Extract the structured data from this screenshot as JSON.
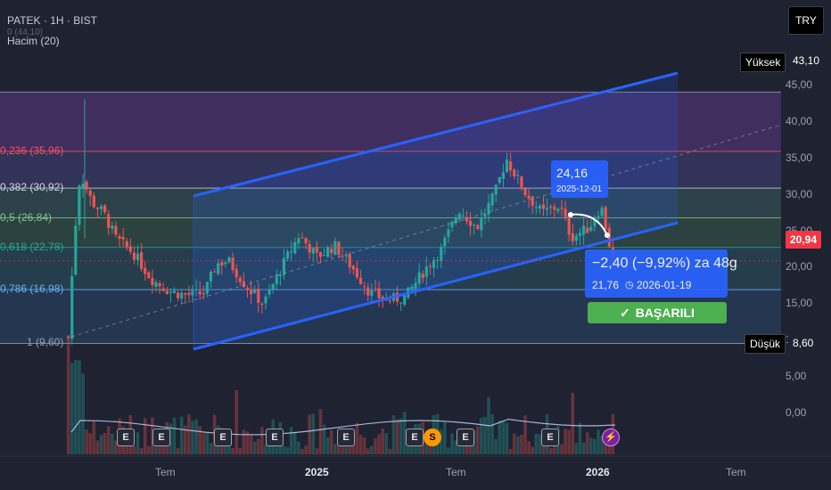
{
  "header": {
    "symbol_line": "PATEK · 1H · BIST",
    "volume_label": "Hacim (20)",
    "cut_label": "0 (44,10)"
  },
  "currency_button": "TRY",
  "y_axis": {
    "ticks": [
      "45,00",
      "40,00",
      "35,00",
      "30,00",
      "25,00",
      "20,00",
      "15,00",
      "10,00",
      "5,00",
      "0,00"
    ],
    "tags": {
      "high_label": "Yüksek",
      "high_value": "43,10",
      "current_value": "20,94",
      "low_label": "Düşük",
      "low_value": "8,60"
    }
  },
  "x_axis": {
    "ticks": [
      {
        "label": "Tem",
        "bold": false
      },
      {
        "label": "2025",
        "bold": true
      },
      {
        "label": "Tem",
        "bold": false
      },
      {
        "label": "2026",
        "bold": true
      },
      {
        "label": "Tem",
        "bold": false
      }
    ]
  },
  "fib_levels": [
    {
      "label": "0,236 (35,96)",
      "color": "#f7525f"
    },
    {
      "label": "0,382 (30,92)",
      "color": "#d1d4dc"
    },
    {
      "label": "0,5 (26,84)",
      "color": "#81c784"
    },
    {
      "label": "0,618 (22,78)",
      "color": "#26a69a"
    },
    {
      "label": "0,786 (16,98)",
      "color": "#64b5f6"
    },
    {
      "label": "1 (9,60)",
      "color": "#9aa0ad"
    }
  ],
  "annotations": {
    "entry_price": "24,16",
    "entry_date": "2025-12-01",
    "move_text": "−2,40 (−9,92%) za 48g",
    "target_price": "21,76",
    "target_date": "2026-01-19",
    "status": "BAŞARILI"
  },
  "events": [
    "E",
    "E",
    "E",
    "E",
    "E",
    "E",
    "S",
    "E",
    "E",
    "⚡"
  ],
  "colors": {
    "up": "#26a69a",
    "down": "#ef5350",
    "channel": "#2962ff",
    "success": "#4caf50"
  },
  "chart_data": {
    "type": "candlestick",
    "title": "PATEK · 1H · BIST",
    "y_range": [
      -4,
      48
    ],
    "fibonacci": [
      {
        "ratio": 0,
        "price": 44.1
      },
      {
        "ratio": 0.236,
        "price": 35.96
      },
      {
        "ratio": 0.382,
        "price": 30.92
      },
      {
        "ratio": 0.5,
        "price": 26.84
      },
      {
        "ratio": 0.618,
        "price": 22.78
      },
      {
        "ratio": 0.786,
        "price": 16.98
      },
      {
        "ratio": 1,
        "price": 9.6
      }
    ],
    "close_series": [
      {
        "date": "2024-04-15",
        "close": 10.5
      },
      {
        "date": "2024-04-22",
        "close": 24.0
      },
      {
        "date": "2024-04-29",
        "close": 33.0
      },
      {
        "date": "2024-05-13",
        "close": 29.0
      },
      {
        "date": "2024-05-27",
        "close": 27.5
      },
      {
        "date": "2024-06-10",
        "close": 24.0
      },
      {
        "date": "2024-07-01",
        "close": 22.0
      },
      {
        "date": "2024-07-22",
        "close": 18.5
      },
      {
        "date": "2024-08-12",
        "close": 16.8
      },
      {
        "date": "2024-09-02",
        "close": 16.2
      },
      {
        "date": "2024-09-23",
        "close": 16.5
      },
      {
        "date": "2024-10-07",
        "close": 20.5
      },
      {
        "date": "2024-10-21",
        "close": 21.0
      },
      {
        "date": "2024-11-11",
        "close": 17.5
      },
      {
        "date": "2024-12-02",
        "close": 15.0
      },
      {
        "date": "2024-12-23",
        "close": 20.0
      },
      {
        "date": "2025-01-13",
        "close": 24.5
      },
      {
        "date": "2025-02-03",
        "close": 21.5
      },
      {
        "date": "2025-02-24",
        "close": 23.0
      },
      {
        "date": "2025-03-17",
        "close": 20.0
      },
      {
        "date": "2025-04-07",
        "close": 16.5
      },
      {
        "date": "2025-04-28",
        "close": 15.5
      },
      {
        "date": "2025-05-19",
        "close": 16.0
      },
      {
        "date": "2025-06-09",
        "close": 19.5
      },
      {
        "date": "2025-06-30",
        "close": 22.5
      },
      {
        "date": "2025-07-21",
        "close": 28.0
      },
      {
        "date": "2025-08-11",
        "close": 25.5
      },
      {
        "date": "2025-09-01",
        "close": 30.0
      },
      {
        "date": "2025-09-15",
        "close": 35.0
      },
      {
        "date": "2025-10-06",
        "close": 30.5
      },
      {
        "date": "2025-10-27",
        "close": 27.5
      },
      {
        "date": "2025-11-17",
        "close": 28.5
      },
      {
        "date": "2025-12-01",
        "close": 24.16
      },
      {
        "date": "2025-12-22",
        "close": 25.5
      },
      {
        "date": "2026-01-05",
        "close": 28.5
      },
      {
        "date": "2026-01-19",
        "close": 20.94
      }
    ],
    "high": 43.1,
    "low": 8.6,
    "current": 20.94,
    "volume_label": "Hacim (20)"
  }
}
